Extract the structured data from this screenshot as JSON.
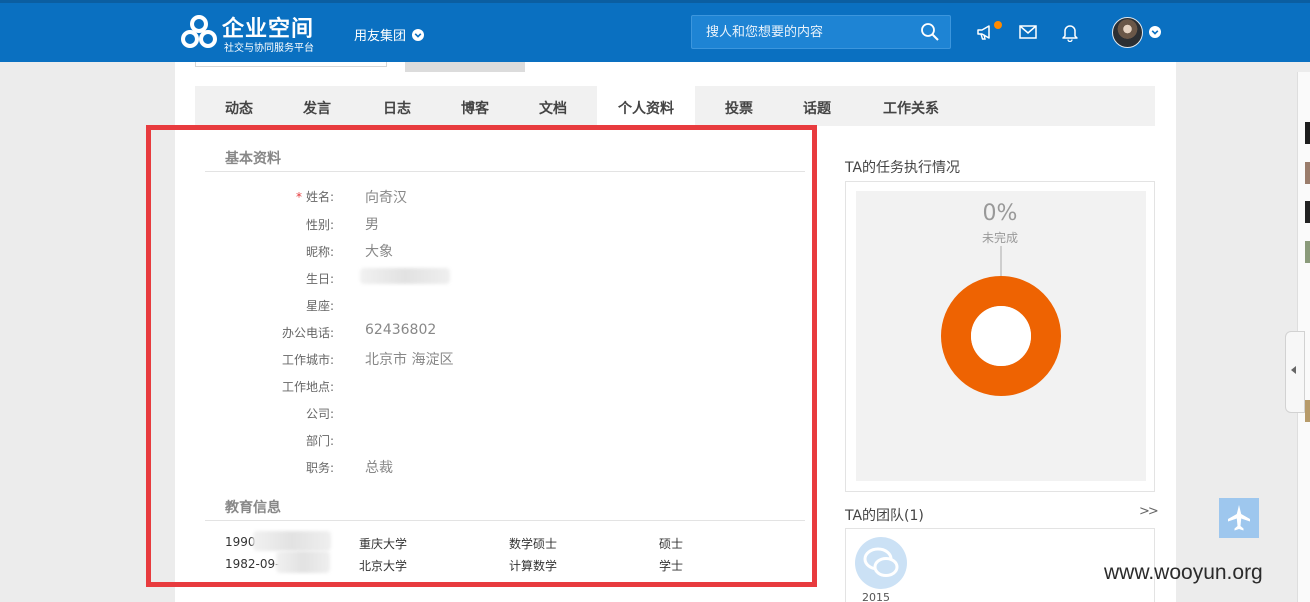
{
  "header": {
    "logo_title": "企业空间",
    "logo_subtitle": "社交与协同服务平台",
    "org_name": "用友集团",
    "search_placeholder": "搜人和您想要的内容",
    "icons": [
      "announcement-icon",
      "mail-icon",
      "bell-icon"
    ],
    "accent_color": "#0a70c1",
    "notify_dot_color": "#ff8a00"
  },
  "tabs": [
    {
      "label": "动态",
      "active": false
    },
    {
      "label": "发言",
      "active": false
    },
    {
      "label": "日志",
      "active": false
    },
    {
      "label": "博客",
      "active": false
    },
    {
      "label": "文档",
      "active": false
    },
    {
      "label": "个人资料",
      "active": true
    },
    {
      "label": "投票",
      "active": false
    },
    {
      "label": "话题",
      "active": false
    },
    {
      "label": "工作关系",
      "active": false
    }
  ],
  "profile": {
    "basic_title": "基本资料",
    "fields": [
      {
        "label": "姓名:",
        "value": "向奇汉",
        "required": true
      },
      {
        "label": "性别:",
        "value": "男"
      },
      {
        "label": "昵称:",
        "value": "大象"
      },
      {
        "label": "生日:",
        "value": "",
        "redacted": true
      },
      {
        "label": "星座:",
        "value": ""
      },
      {
        "label": "办公电话:",
        "value": "62436802"
      },
      {
        "label": "工作城市:",
        "value": "北京市 海淀区"
      },
      {
        "label": "工作地点:",
        "value": ""
      },
      {
        "label": "公司:",
        "value": ""
      },
      {
        "label": "部门:",
        "value": ""
      },
      {
        "label": "职务:",
        "value": "总裁"
      }
    ],
    "required_mark": "*",
    "education_title": "教育信息",
    "education": [
      {
        "period": "1990",
        "school": "重庆大学",
        "major": "数学硕士",
        "degree": "硕士"
      },
      {
        "period": "1982-09-",
        "school": "北京大学",
        "major": "计算数学",
        "degree": "学士"
      }
    ]
  },
  "sidebar": {
    "task_title": "TA的任务执行情况",
    "task_percent": "0%",
    "task_status": "未完成",
    "task_completed_fraction": 0,
    "donut_color": "#ee6302",
    "team_title": "TA的团队(1)",
    "more_arrows": ">>",
    "team_year": "2015"
  },
  "watermark": "www.wooyun.org",
  "highlight_color": "#e83b3e"
}
